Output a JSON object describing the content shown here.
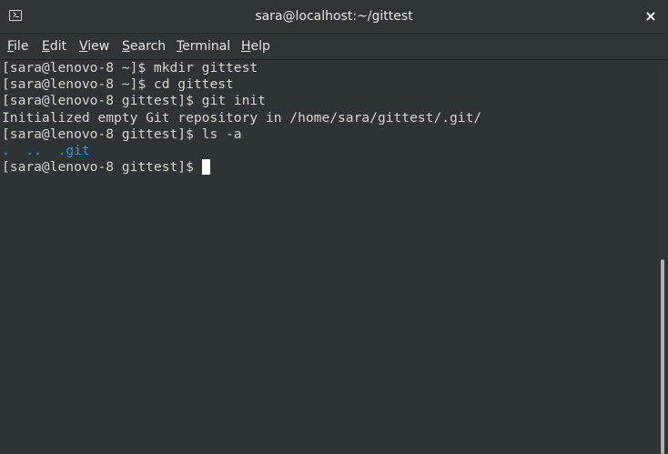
{
  "window": {
    "title": "sara@localhost:~/gittest",
    "icon": "terminal-icon",
    "close_label": "×"
  },
  "menu": {
    "items": [
      {
        "mnemonic": "F",
        "rest": "ile"
      },
      {
        "mnemonic": "E",
        "rest": "dit"
      },
      {
        "mnemonic": "V",
        "rest": "iew"
      },
      {
        "mnemonic": "S",
        "rest": "earch"
      },
      {
        "mnemonic": "T",
        "rest": "erminal"
      },
      {
        "mnemonic": "H",
        "rest": "elp"
      }
    ]
  },
  "terminal": {
    "lines": [
      "[sara@lenovo-8 ~]$ mkdir gittest",
      "[sara@lenovo-8 ~]$ cd gittest",
      "[sara@lenovo-8 gittest]$ git init",
      "Initialized empty Git repository in /home/sara/gittest/.git/",
      "[sara@lenovo-8 gittest]$ ls -a"
    ],
    "ls_output": [
      ".",
      "..",
      ".git"
    ],
    "prompt": "[sara@lenovo-8 gittest]$ "
  },
  "colors": {
    "background": "#2e3436",
    "foreground": "#d3d7cf",
    "directory": "#3d8ee6",
    "cursor": "#ffffff"
  }
}
